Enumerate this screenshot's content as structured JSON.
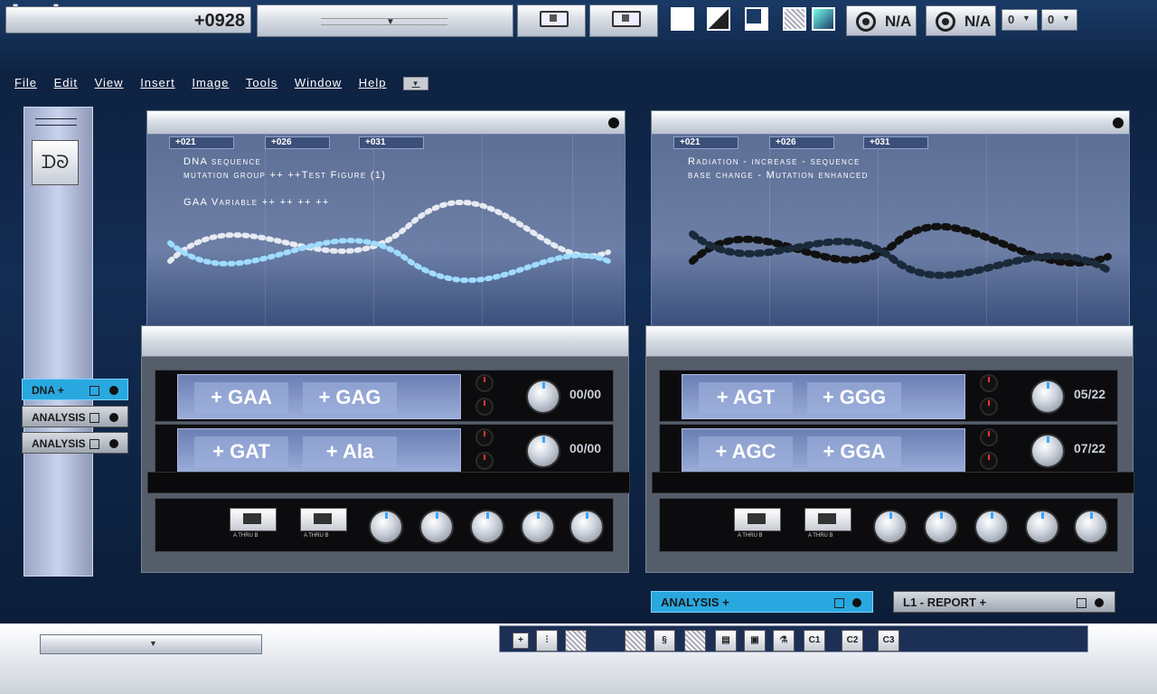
{
  "topbar": {
    "counter": "+0928",
    "na1": "N/A",
    "na2": "N/A",
    "sel1": "0",
    "sel2": "0"
  },
  "menu": [
    "File",
    "Edit",
    "View",
    "Insert",
    "Image",
    "Tools",
    "Window",
    "Help"
  ],
  "sidebar": {
    "tabs": [
      {
        "label": "DNA +",
        "active": true
      },
      {
        "label": "ANALYSIS",
        "active": false
      },
      {
        "label": "ANALYSIS",
        "active": false
      }
    ]
  },
  "left_panel": {
    "chips": [
      "+021",
      "+026",
      "+031"
    ],
    "line1": "DNA sequence",
    "line2": "mutation group ++ ++Test Figure (1)",
    "line3": "GAA Variable ++ ++ ++ ++",
    "rows": [
      {
        "codes": [
          "+ GAA",
          "+ GAG"
        ],
        "count": "00/00"
      },
      {
        "codes": [
          "+ GAT",
          "+ Ala"
        ],
        "count": "00/00"
      }
    ],
    "toggle_label": "A  THRU  B"
  },
  "right_panel": {
    "chips": [
      "+021",
      "+026",
      "+031"
    ],
    "line1": "Radiation - increase - sequence",
    "line2": "base change - Mutation enhanced",
    "rows": [
      {
        "codes": [
          "+ AGT",
          "+ GGG"
        ],
        "count": "05/22"
      },
      {
        "codes": [
          "+ AGC",
          "+ GGA"
        ],
        "count": "07/22"
      }
    ],
    "toggle_label": "A  THRU  B"
  },
  "bottom_tabs": {
    "analysis": "ANALYSIS +",
    "report": "L1 - REPORT +"
  },
  "bottom_toolbar": {
    "c1": "C1",
    "c2": "C2",
    "c3": "C3",
    "plus": "+"
  },
  "colors": {
    "accent": "#29a8e0",
    "panel_bg": "#6d7fa6"
  }
}
